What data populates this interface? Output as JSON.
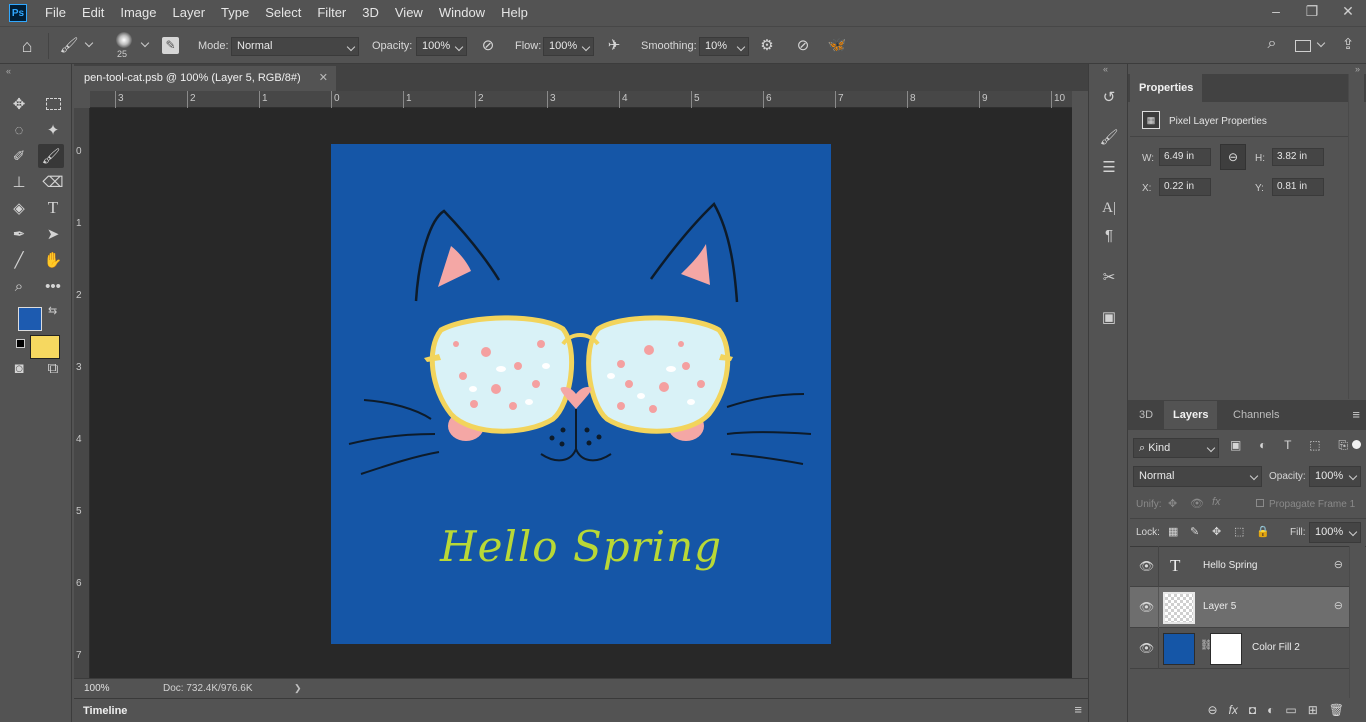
{
  "app": {
    "logo": "Ps"
  },
  "menu": [
    "File",
    "Edit",
    "Image",
    "Layer",
    "Type",
    "Select",
    "Filter",
    "3D",
    "View",
    "Window",
    "Help"
  ],
  "window_controls": {
    "minimize": "–",
    "restore": "❐",
    "close": "✕"
  },
  "options": {
    "brush_size": "25",
    "mode_label": "Mode:",
    "mode_value": "Normal",
    "opacity_label": "Opacity:",
    "opacity_value": "100%",
    "flow_label": "Flow:",
    "flow_value": "100%",
    "smoothing_label": "Smoothing:",
    "smoothing_value": "10%"
  },
  "document": {
    "tab_title": "pen-tool-cat.psb @ 100% (Layer 5, RGB/8#)",
    "close": "✕",
    "ruler_h": [
      "3",
      "2",
      "1",
      "0",
      "1",
      "2",
      "3",
      "4",
      "5",
      "6",
      "7",
      "8",
      "9",
      "10"
    ],
    "ruler_v": [
      "0",
      "1",
      "2",
      "3",
      "4",
      "5",
      "6",
      "7"
    ],
    "canvas_text": "Hello Spring",
    "canvas_bg": "#1556a7",
    "text_color": "#b9d836"
  },
  "status": {
    "zoom": "100%",
    "doc": "Doc: 732.4K/976.6K",
    "arrow": "❯"
  },
  "timeline": {
    "label": "Timeline"
  },
  "colors": {
    "foreground": "#1d5bb0",
    "background": "#f6d860"
  },
  "properties": {
    "tab": "Properties",
    "heading": "Pixel Layer Properties",
    "w_label": "W:",
    "w_value": "6.49 in",
    "h_label": "H:",
    "h_value": "3.82 in",
    "x_label": "X:",
    "x_value": "0.22 in",
    "y_label": "Y:",
    "y_value": "0.81 in"
  },
  "layers_panel": {
    "tabs": [
      "3D",
      "Layers",
      "Channels"
    ],
    "kind_label": "Kind",
    "blend_mode": "Normal",
    "opacity_label": "Opacity:",
    "opacity_value": "100%",
    "unify_label": "Unify:",
    "propagate_label": "Propagate Frame 1",
    "lock_label": "Lock:",
    "fill_label": "Fill:",
    "fill_value": "100%",
    "layers": [
      {
        "name": "Hello Spring",
        "type": "text"
      },
      {
        "name": "Layer 5",
        "type": "pixel"
      },
      {
        "name": "Color Fill 2",
        "type": "fill"
      }
    ]
  }
}
